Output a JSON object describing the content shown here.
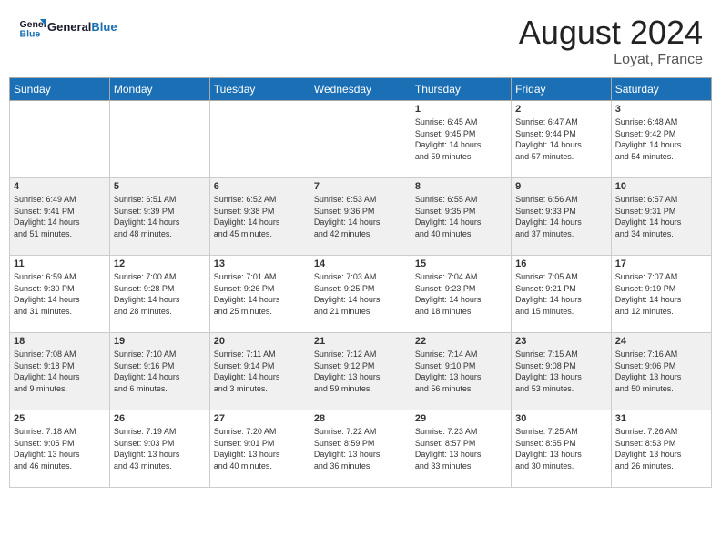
{
  "header": {
    "logo_text_general": "General",
    "logo_text_blue": "Blue",
    "month_title": "August 2024",
    "location": "Loyat, France"
  },
  "days_of_week": [
    "Sunday",
    "Monday",
    "Tuesday",
    "Wednesday",
    "Thursday",
    "Friday",
    "Saturday"
  ],
  "weeks": [
    [
      {
        "num": "",
        "info": ""
      },
      {
        "num": "",
        "info": ""
      },
      {
        "num": "",
        "info": ""
      },
      {
        "num": "",
        "info": ""
      },
      {
        "num": "1",
        "info": "Sunrise: 6:45 AM\nSunset: 9:45 PM\nDaylight: 14 hours\nand 59 minutes."
      },
      {
        "num": "2",
        "info": "Sunrise: 6:47 AM\nSunset: 9:44 PM\nDaylight: 14 hours\nand 57 minutes."
      },
      {
        "num": "3",
        "info": "Sunrise: 6:48 AM\nSunset: 9:42 PM\nDaylight: 14 hours\nand 54 minutes."
      }
    ],
    [
      {
        "num": "4",
        "info": "Sunrise: 6:49 AM\nSunset: 9:41 PM\nDaylight: 14 hours\nand 51 minutes."
      },
      {
        "num": "5",
        "info": "Sunrise: 6:51 AM\nSunset: 9:39 PM\nDaylight: 14 hours\nand 48 minutes."
      },
      {
        "num": "6",
        "info": "Sunrise: 6:52 AM\nSunset: 9:38 PM\nDaylight: 14 hours\nand 45 minutes."
      },
      {
        "num": "7",
        "info": "Sunrise: 6:53 AM\nSunset: 9:36 PM\nDaylight: 14 hours\nand 42 minutes."
      },
      {
        "num": "8",
        "info": "Sunrise: 6:55 AM\nSunset: 9:35 PM\nDaylight: 14 hours\nand 40 minutes."
      },
      {
        "num": "9",
        "info": "Sunrise: 6:56 AM\nSunset: 9:33 PM\nDaylight: 14 hours\nand 37 minutes."
      },
      {
        "num": "10",
        "info": "Sunrise: 6:57 AM\nSunset: 9:31 PM\nDaylight: 14 hours\nand 34 minutes."
      }
    ],
    [
      {
        "num": "11",
        "info": "Sunrise: 6:59 AM\nSunset: 9:30 PM\nDaylight: 14 hours\nand 31 minutes."
      },
      {
        "num": "12",
        "info": "Sunrise: 7:00 AM\nSunset: 9:28 PM\nDaylight: 14 hours\nand 28 minutes."
      },
      {
        "num": "13",
        "info": "Sunrise: 7:01 AM\nSunset: 9:26 PM\nDaylight: 14 hours\nand 25 minutes."
      },
      {
        "num": "14",
        "info": "Sunrise: 7:03 AM\nSunset: 9:25 PM\nDaylight: 14 hours\nand 21 minutes."
      },
      {
        "num": "15",
        "info": "Sunrise: 7:04 AM\nSunset: 9:23 PM\nDaylight: 14 hours\nand 18 minutes."
      },
      {
        "num": "16",
        "info": "Sunrise: 7:05 AM\nSunset: 9:21 PM\nDaylight: 14 hours\nand 15 minutes."
      },
      {
        "num": "17",
        "info": "Sunrise: 7:07 AM\nSunset: 9:19 PM\nDaylight: 14 hours\nand 12 minutes."
      }
    ],
    [
      {
        "num": "18",
        "info": "Sunrise: 7:08 AM\nSunset: 9:18 PM\nDaylight: 14 hours\nand 9 minutes."
      },
      {
        "num": "19",
        "info": "Sunrise: 7:10 AM\nSunset: 9:16 PM\nDaylight: 14 hours\nand 6 minutes."
      },
      {
        "num": "20",
        "info": "Sunrise: 7:11 AM\nSunset: 9:14 PM\nDaylight: 14 hours\nand 3 minutes."
      },
      {
        "num": "21",
        "info": "Sunrise: 7:12 AM\nSunset: 9:12 PM\nDaylight: 13 hours\nand 59 minutes."
      },
      {
        "num": "22",
        "info": "Sunrise: 7:14 AM\nSunset: 9:10 PM\nDaylight: 13 hours\nand 56 minutes."
      },
      {
        "num": "23",
        "info": "Sunrise: 7:15 AM\nSunset: 9:08 PM\nDaylight: 13 hours\nand 53 minutes."
      },
      {
        "num": "24",
        "info": "Sunrise: 7:16 AM\nSunset: 9:06 PM\nDaylight: 13 hours\nand 50 minutes."
      }
    ],
    [
      {
        "num": "25",
        "info": "Sunrise: 7:18 AM\nSunset: 9:05 PM\nDaylight: 13 hours\nand 46 minutes."
      },
      {
        "num": "26",
        "info": "Sunrise: 7:19 AM\nSunset: 9:03 PM\nDaylight: 13 hours\nand 43 minutes."
      },
      {
        "num": "27",
        "info": "Sunrise: 7:20 AM\nSunset: 9:01 PM\nDaylight: 13 hours\nand 40 minutes."
      },
      {
        "num": "28",
        "info": "Sunrise: 7:22 AM\nSunset: 8:59 PM\nDaylight: 13 hours\nand 36 minutes."
      },
      {
        "num": "29",
        "info": "Sunrise: 7:23 AM\nSunset: 8:57 PM\nDaylight: 13 hours\nand 33 minutes."
      },
      {
        "num": "30",
        "info": "Sunrise: 7:25 AM\nSunset: 8:55 PM\nDaylight: 13 hours\nand 30 minutes."
      },
      {
        "num": "31",
        "info": "Sunrise: 7:26 AM\nSunset: 8:53 PM\nDaylight: 13 hours\nand 26 minutes."
      }
    ]
  ]
}
